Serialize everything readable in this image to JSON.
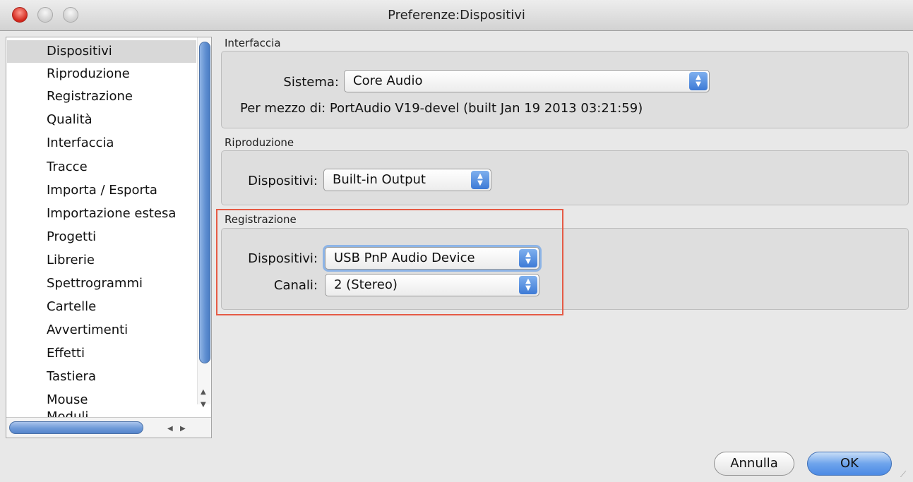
{
  "window": {
    "title": "Preferenze:Dispositivi"
  },
  "sidebar": {
    "items": [
      {
        "label": "Dispositivi",
        "selected": true
      },
      {
        "label": "Riproduzione"
      },
      {
        "label": "Registrazione"
      },
      {
        "label": "Qualità"
      },
      {
        "label": "Interfaccia"
      },
      {
        "label": "Tracce"
      },
      {
        "label": "Importa / Esporta"
      },
      {
        "label": "Importazione estesa"
      },
      {
        "label": "Progetti"
      },
      {
        "label": "Librerie"
      },
      {
        "label": "Spettrogrammi"
      },
      {
        "label": "Cartelle"
      },
      {
        "label": "Avvertimenti"
      },
      {
        "label": "Effetti"
      },
      {
        "label": "Tastiera"
      },
      {
        "label": "Mouse"
      },
      {
        "label": "Moduli"
      }
    ]
  },
  "interface_group": {
    "title": "Interfaccia",
    "system_label": "Sistema:",
    "system_value": "Core Audio",
    "via_text": "Per mezzo di: PortAudio V19-devel (built Jan 19 2013 03:21:59)"
  },
  "playback_group": {
    "title": "Riproduzione",
    "device_label": "Dispositivi:",
    "device_value": "Built-in Output"
  },
  "recording_group": {
    "title": "Registrazione",
    "device_label": "Dispositivi:",
    "device_value": "USB PnP Audio Device",
    "channels_label": "Canali:",
    "channels_value": "2 (Stereo)"
  },
  "buttons": {
    "cancel": "Annulla",
    "ok": "OK"
  },
  "colors": {
    "accent": "#4c8ae4",
    "highlight_box": "#e55a45",
    "close_button": "#d2251a"
  }
}
